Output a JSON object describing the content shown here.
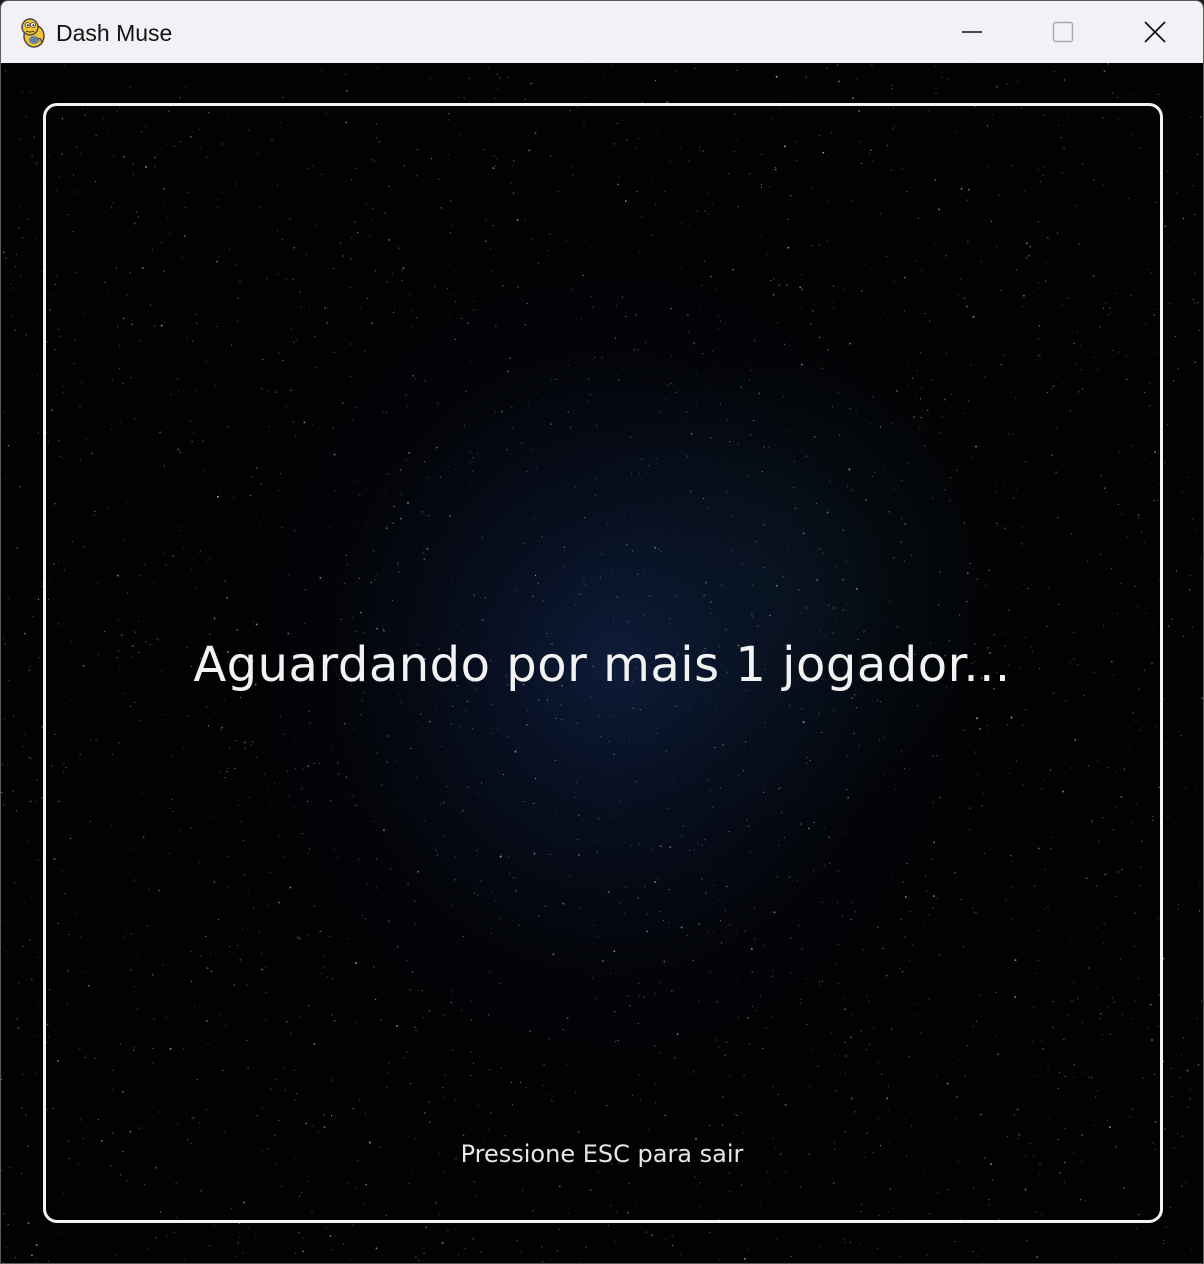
{
  "window": {
    "title": "Dash Muse",
    "app_icon": "python-snake-icon",
    "controls": {
      "minimize": "minimize-icon",
      "maximize": "maximize-icon",
      "close": "close-icon"
    }
  },
  "game": {
    "waiting_message": "Aguardando por mais 1 jogador...",
    "exit_hint": "Pressione ESC para sair"
  },
  "colors": {
    "background": "#020203",
    "glow": "#10224a",
    "frame": "#f2f2f2",
    "text": "#f2f2f2",
    "titlebar": "#f3f1f6"
  }
}
